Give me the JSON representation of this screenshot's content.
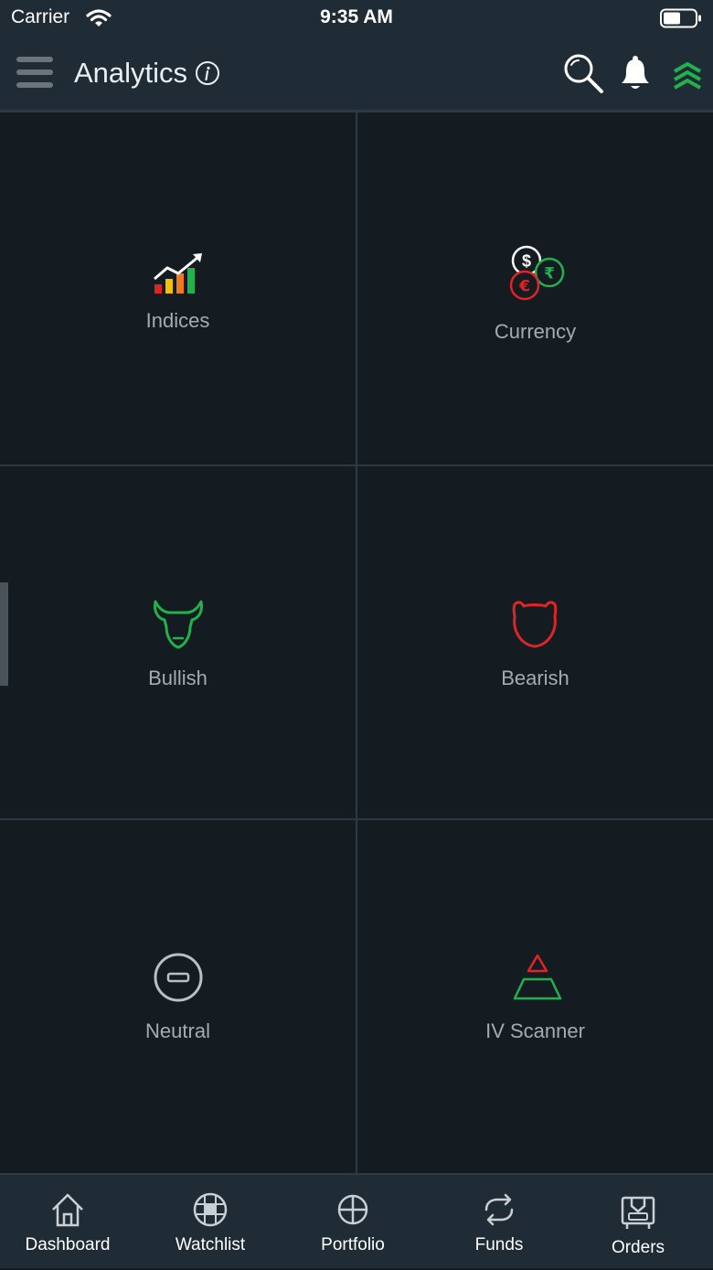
{
  "status_bar": {
    "carrier": "Carrier",
    "time": "9:35 AM"
  },
  "header": {
    "title": "Analytics"
  },
  "tiles": [
    {
      "label": "Indices"
    },
    {
      "label": "Currency"
    },
    {
      "label": "Bullish"
    },
    {
      "label": "Bearish"
    },
    {
      "label": "Neutral"
    },
    {
      "label": "IV Scanner"
    }
  ],
  "bottom_nav": [
    {
      "label": "Dashboard"
    },
    {
      "label": "Watchlist"
    },
    {
      "label": "Portfolio"
    },
    {
      "label": "Funds"
    },
    {
      "label": "Orders"
    }
  ],
  "colors": {
    "background": "#141c22",
    "header": "#1f2c36",
    "accent_green": "#22b14c",
    "accent_red": "#e02424",
    "label_gray": "#a3acb3"
  }
}
